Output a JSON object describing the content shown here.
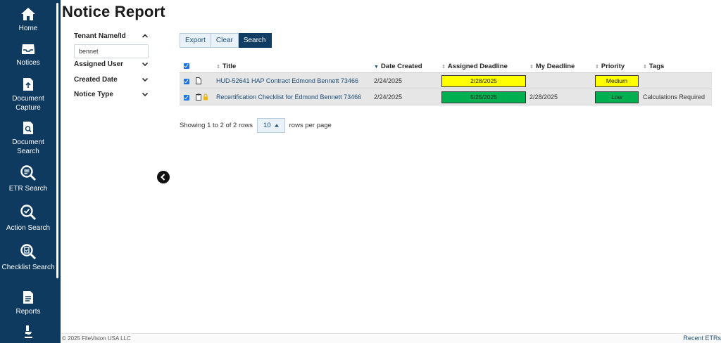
{
  "sidebar": {
    "items": [
      {
        "label": "Home",
        "icon": "home-icon"
      },
      {
        "label": "Notices",
        "icon": "inbox-icon"
      },
      {
        "label": "Document Capture",
        "icon": "file-upload-icon"
      },
      {
        "label": "Document Search",
        "icon": "file-search-icon"
      },
      {
        "label": "ETR Search",
        "icon": "etr-search-icon"
      },
      {
        "label": "Action Search",
        "icon": "action-search-icon"
      },
      {
        "label": "Checklist Search",
        "icon": "checklist-search-icon"
      },
      {
        "label": "Reports",
        "icon": "report-icon"
      },
      {
        "label": "",
        "icon": "microscope-icon"
      }
    ],
    "background": "#0f3a5f"
  },
  "header": {
    "title": "Notice Report"
  },
  "filters": {
    "tenant": {
      "label": "Tenant Name/Id",
      "value": "bennet"
    },
    "assigned_user": {
      "label": "Assigned User"
    },
    "created_date": {
      "label": "Created Date"
    },
    "notice_type": {
      "label": "Notice Type"
    }
  },
  "toolbar": {
    "export": "Export",
    "clear": "Clear",
    "search": "Search"
  },
  "table": {
    "columns": {
      "title": "Title",
      "date_created": "Date Created",
      "assigned_deadline": "Assigned Deadline",
      "my_deadline": "My Deadline",
      "priority": "Priority",
      "tags": "Tags"
    },
    "rows": [
      {
        "title": "HUD-52641 HAP Contract Edmond Bennett 73466",
        "date_created": "2/24/2025",
        "assigned_deadline": "2/28/2025",
        "assigned_deadline_color": "#ffff00",
        "my_deadline": "",
        "priority": "Medium",
        "priority_color": "#ffff00",
        "tags": ""
      },
      {
        "title": "Recertification Checklist for Edmond Bennett 73466",
        "date_created": "2/24/2025",
        "assigned_deadline": "5/25/2025",
        "assigned_deadline_color": "#00b050",
        "my_deadline": "2/28/2025",
        "priority": "Low",
        "priority_color": "#00b050",
        "tags": "Calculations Required"
      }
    ]
  },
  "pagination": {
    "summary": "Showing 1 to 2 of 2 rows",
    "page_size": "10",
    "suffix": "rows per page"
  },
  "footer": {
    "copyright": "© 2025 FileVision USA LLC",
    "recent": "Recent ETRs"
  }
}
